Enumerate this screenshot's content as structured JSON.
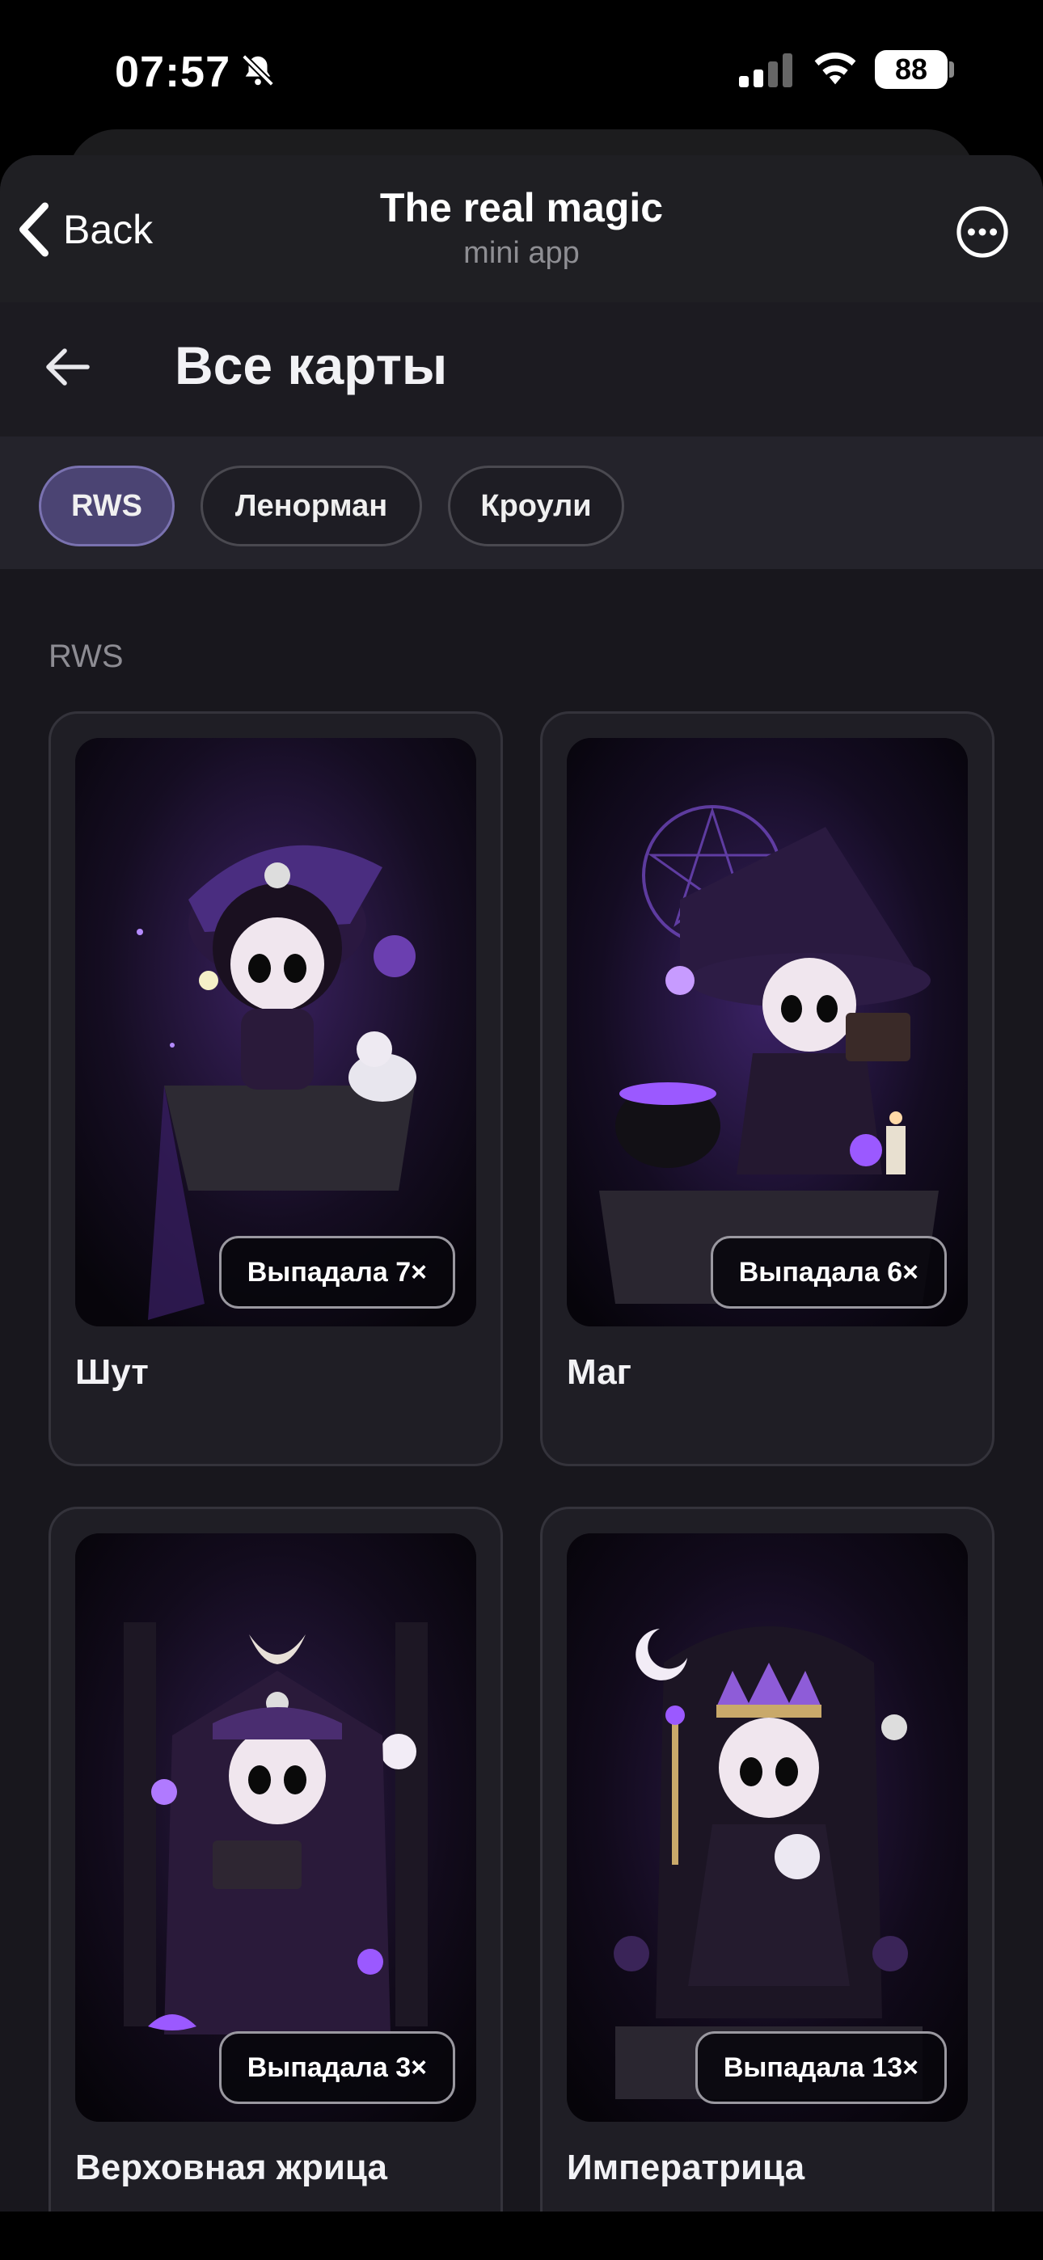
{
  "status_bar": {
    "time": "07:57",
    "battery": "88",
    "icons": [
      "bell-slash-icon",
      "signal-icon",
      "wifi-icon",
      "battery-icon"
    ]
  },
  "mini_app_header": {
    "back_label": "Back",
    "title": "The real magic",
    "subtitle": "mini app",
    "more_icon": "ellipsis-circle-icon"
  },
  "page": {
    "title": "Все карты",
    "back_icon": "arrow-left-icon"
  },
  "filters": {
    "tabs": [
      {
        "label": "RWS",
        "active": true
      },
      {
        "label": "Ленорман",
        "active": false
      },
      {
        "label": "Кроули",
        "active": false
      }
    ]
  },
  "section": {
    "label": "RWS"
  },
  "cards": [
    {
      "name": "Шут",
      "badge": "Выпадала 7×"
    },
    {
      "name": "Маг",
      "badge": "Выпадала 6×"
    },
    {
      "name": "Верховная жрица",
      "badge": "Выпадала 3×"
    },
    {
      "name": "Императрица",
      "badge": "Выпадала 13×"
    }
  ],
  "colors": {
    "accent_chip": "#4b4473",
    "card_bg": "#1f1e25",
    "glow_purple": "#9b59ff"
  }
}
